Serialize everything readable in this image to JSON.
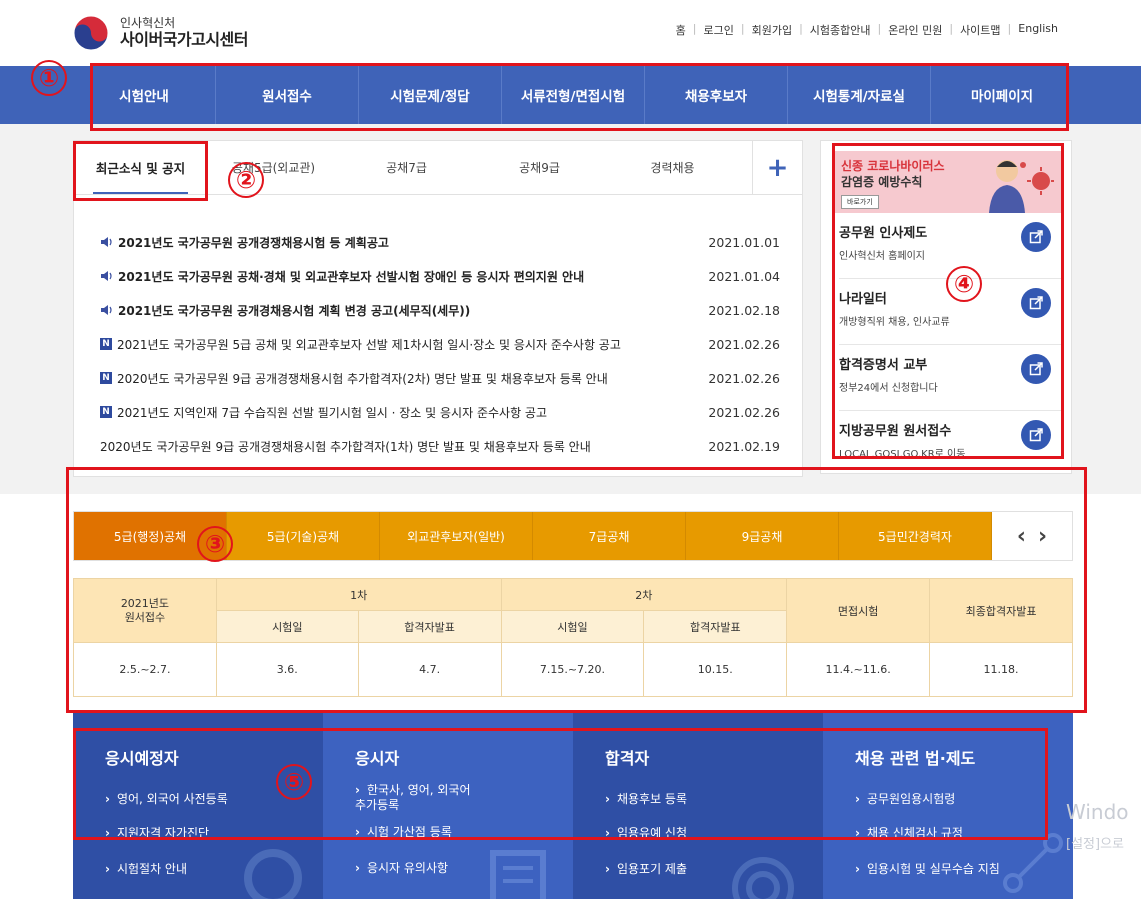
{
  "header": {
    "logo_sub": "인사혁신처",
    "logo_main": "사이버국가고시센터",
    "util": [
      "홈",
      "로그인",
      "회원가입",
      "시험종합안내",
      "온라인 민원",
      "사이트맵",
      "English"
    ]
  },
  "gnb": [
    "시험안내",
    "원서접수",
    "시험문제/정답",
    "서류전형/면접시험",
    "채용후보자",
    "시험통계/자료실",
    "마이페이지"
  ],
  "notice": {
    "tabs": [
      "최근소식 및 공지",
      "공채5급(외교관)",
      "공채7급",
      "공채9급",
      "경력채용"
    ],
    "plus": "+",
    "items": [
      {
        "type": "speaker",
        "title": "2021년도 국가공무원 공개경쟁채용시험 등 계획공고",
        "date": "2021.01.01"
      },
      {
        "type": "speaker",
        "title": "2021년도 국가공무원 공채·경채 및 외교관후보자 선발시험 장애인 등 응시자 편의지원 안내",
        "date": "2021.01.04"
      },
      {
        "type": "speaker",
        "title": "2021년도 국가공무원 공개경채용시험 계획 변경 공고(세무직(세무))",
        "date": "2021.02.18"
      },
      {
        "type": "new",
        "title": "2021년도 국가공무원 5급 공채 및 외교관후보자 선발 제1차시험 일시·장소 및 응시자 준수사항 공고",
        "date": "2021.02.26"
      },
      {
        "type": "new",
        "title": "2020년도 국가공무원 9급 공개경쟁채용시험 추가합격자(2차) 명단 발표 및 채용후보자 등록 안내",
        "date": "2021.02.26"
      },
      {
        "type": "new",
        "title": "2021년도 지역인재 7급 수습직원 선발 필기시험 일시 · 장소 및 응시자 준수사항 공고",
        "date": "2021.02.26"
      },
      {
        "type": "plain",
        "title": "2020년도 국가공무원 9급 공개경쟁채용시험 추가합격자(1차) 명단 발표 및 채용후보자 등록 안내",
        "date": "2021.02.19"
      }
    ],
    "new_badge": "N"
  },
  "side": {
    "banner_line1": "신종 코로나바이러스",
    "banner_line2": "감염증 예방수칙",
    "banner_btn": "바로가기",
    "items": [
      {
        "title": "공무원 인사제도",
        "desc": "인사혁신처 홈페이지"
      },
      {
        "title": "나라일터",
        "desc": "개방형직위 채용, 인사교류"
      },
      {
        "title": "합격증명서 교부",
        "desc": "정부24에서 신청합니다"
      },
      {
        "title": "지방공무원 원서접수",
        "desc": "LOCAL.GOSI.GO.KR로 이동"
      }
    ]
  },
  "schedule": {
    "tabs": [
      "5급(행정)공채",
      "5급(기술)공채",
      "외교관후보자(일반)",
      "7급공채",
      "9급공채",
      "5급민간경력자"
    ],
    "prev": "‹",
    "next": "›",
    "head_first": "2021년도\n원서접수",
    "phase1": "1차",
    "phase2": "2차",
    "interview": "면접시험",
    "final": "최종합격자발표",
    "sub": [
      "시험일",
      "합격자발표",
      "시험일",
      "합격자발표"
    ],
    "values": [
      "2.5.~2.7.",
      "3.6.",
      "4.7.",
      "7.15.~7.20.",
      "10.15.",
      "11.4.~11.6.",
      "11.18."
    ]
  },
  "quick": [
    {
      "title": "응시예정자",
      "links": [
        "영어, 외국어 사전등록",
        "지원자격 자가진단",
        "시험절차 안내"
      ]
    },
    {
      "title": "응시자",
      "links": [
        "한국사, 영어, 외국어\n추가등록",
        "시험 가산점 등록",
        "응시자 유의사항"
      ]
    },
    {
      "title": "합격자",
      "links": [
        "채용후보 등록",
        "임용유예 신청",
        "임용포기 제출"
      ]
    },
    {
      "title": "채용 관련 법·제도",
      "links": [
        "공무원임용시험령",
        "채용 신체검사 규정",
        "임용시험 및 실무수습 지침"
      ]
    }
  ],
  "annotations": [
    "①",
    "②",
    "③",
    "④",
    "⑤"
  ],
  "watermark": {
    "line1": "Windo",
    "line2": "[설정]으로"
  },
  "colors": {
    "gnb": "#3f63b8",
    "accent_orange": "#e79a00",
    "annotation_red": "#e1141c",
    "quick_blue": "#3358b2"
  }
}
